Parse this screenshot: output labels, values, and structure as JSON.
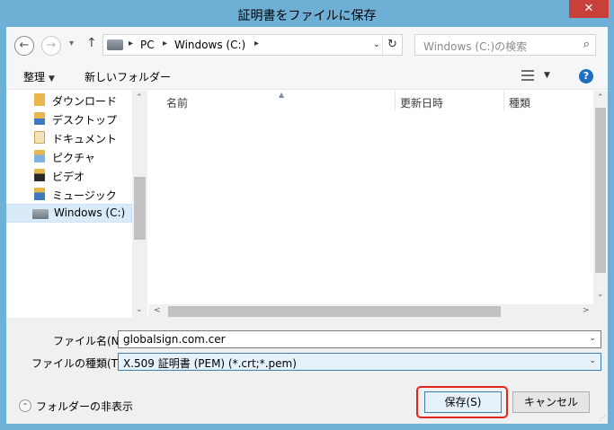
{
  "window": {
    "title": "証明書をファイルに保存",
    "close_glyph": "✕"
  },
  "nav_buttons": {
    "back_glyph": "←",
    "forward_glyph": "→",
    "recent_glyph": "▾",
    "up_glyph": "↑"
  },
  "address": {
    "sep_glyph": "▸",
    "segments": [
      "PC",
      "Windows (C:)"
    ],
    "dropdown_glyph": "⌄",
    "refresh_glyph": "↻"
  },
  "search": {
    "placeholder": "Windows (C:)の検索",
    "icon_glyph": "⌕"
  },
  "toolbar": {
    "organize_label": "整理",
    "dropdown_glyph": "▼",
    "new_folder_label": "新しいフォルダー",
    "help_glyph": "?"
  },
  "nav_pane": {
    "items": [
      {
        "label": "ダウンロード",
        "icon": "download-folder-icon"
      },
      {
        "label": "デスクトップ",
        "icon": "desktop-folder-icon"
      },
      {
        "label": "ドキュメント",
        "icon": "documents-folder-icon"
      },
      {
        "label": "ピクチャ",
        "icon": "pictures-folder-icon"
      },
      {
        "label": "ビデオ",
        "icon": "videos-folder-icon"
      },
      {
        "label": "ミュージック",
        "icon": "music-folder-icon"
      },
      {
        "label": "Windows (C:)",
        "icon": "drive-icon",
        "selected": true
      }
    ],
    "scroll_up_glyph": "⌃",
    "scroll_down_glyph": "⌄"
  },
  "file_list": {
    "sort_glyph": "▲",
    "columns": [
      "名前",
      "更新日時",
      "種類"
    ],
    "scroll_left_glyph": "<",
    "scroll_right_glyph": ">"
  },
  "form": {
    "filename_label": "ファイル名(N):",
    "filename_value": "globalsign.com.cer",
    "filetype_label": "ファイルの種類(T):",
    "filetype_value": "X.509 証明書 (PEM) (*.crt;*.pem)",
    "dropdown_glyph": "⌄"
  },
  "footer": {
    "hide_folders_label": "フォルダーの非表示",
    "hide_folders_glyph": "⌃",
    "save_label": "保存(S)",
    "cancel_label": "キャンセル",
    "grip_glyph": "⋰"
  },
  "colors": {
    "title_bar": "#6eb0d5",
    "close_button": "#c7403a",
    "highlight_border": "#e0251f",
    "selection": "#d9eaf9"
  }
}
